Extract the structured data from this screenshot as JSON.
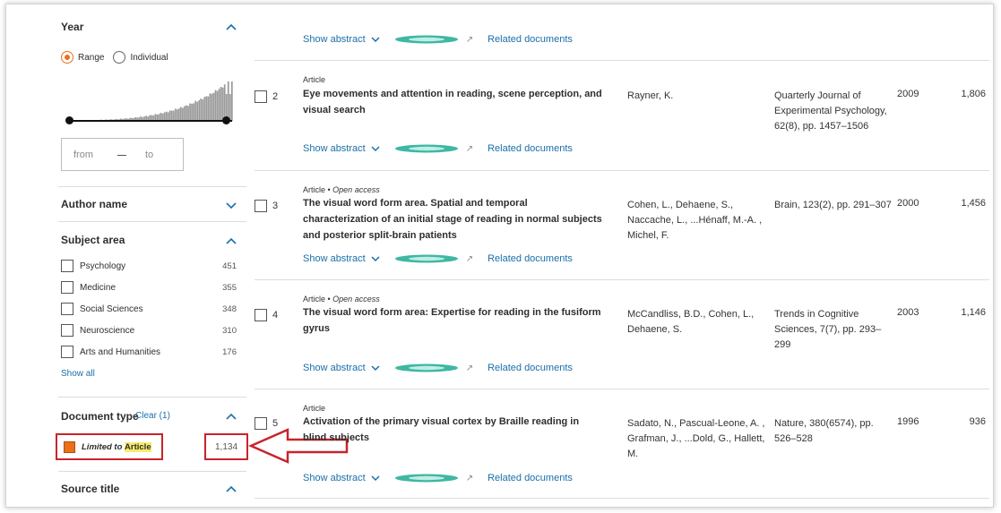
{
  "sidebar": {
    "year": {
      "title": "Year",
      "options": [
        {
          "label": "Range",
          "selected": true
        },
        {
          "label": "Individual",
          "selected": false
        }
      ],
      "from_placeholder": "from",
      "to_placeholder": "to"
    },
    "author_name": {
      "title": "Author name"
    },
    "subject_area": {
      "title": "Subject area",
      "items": [
        {
          "label": "Psychology",
          "count": "451"
        },
        {
          "label": "Medicine",
          "count": "355"
        },
        {
          "label": "Social Sciences",
          "count": "348"
        },
        {
          "label": "Neuroscience",
          "count": "310"
        },
        {
          "label": "Arts and Humanities",
          "count": "176"
        }
      ],
      "show_all": "Show all"
    },
    "document_type": {
      "title": "Document type",
      "clear": "Clear (1)",
      "limited_prefix": "Limited to",
      "limited_value": "Article",
      "count": "1,134"
    },
    "source_title": {
      "title": "Source title"
    }
  },
  "row_actions": {
    "show_abstract": "Show abstract",
    "related": "Related documents"
  },
  "results": [
    {
      "number": "2",
      "doctype": "Article",
      "access": "",
      "title": "Eye movements and attention in reading, scene perception, and visual search",
      "authors": "Rayner, K.",
      "source": "Quarterly Journal of Experimental Psychology, 62(8), pp. 1457–1506",
      "year": "2009",
      "cites": "1,806"
    },
    {
      "number": "3",
      "doctype": "Article",
      "access": "Open access",
      "title": "The visual word form area. Spatial and temporal characterization of an initial stage of reading in normal subjects and posterior split-brain patients",
      "authors": "Cohen, L., Dehaene, S., Naccache, L., ...Hénaff, M.-A. , Michel, F.",
      "source": "Brain, 123(2), pp. 291–307",
      "year": "2000",
      "cites": "1,456"
    },
    {
      "number": "4",
      "doctype": "Article",
      "access": "Open access",
      "title": "The visual word form area: Expertise for reading in the fusiform gyrus",
      "authors": "McCandliss, B.D., Cohen, L., Dehaene, S.",
      "source": "Trends in Cognitive Sciences, 7(7), pp. 293–299",
      "year": "2003",
      "cites": "1,146"
    },
    {
      "number": "5",
      "doctype": "Article",
      "access": "",
      "title": "Activation of the primary visual cortex by Braille reading in blind subjects",
      "authors": "Sadato, N., Pascual-Leone, A. , Grafman, J., ...Dold, G., Hallett, M.",
      "source": "Nature, 380(6574), pp. 526–528",
      "year": "1996",
      "cites": "936"
    }
  ],
  "colors": {
    "accent": "#e9711c",
    "link": "#1a6fa9",
    "annotation": "#c8242c",
    "highlight": "#f7ec6d"
  },
  "icons": [
    "chevron-up-icon",
    "chevron-down-icon",
    "pill-icon",
    "external-link-icon",
    "annotation-arrow"
  ]
}
